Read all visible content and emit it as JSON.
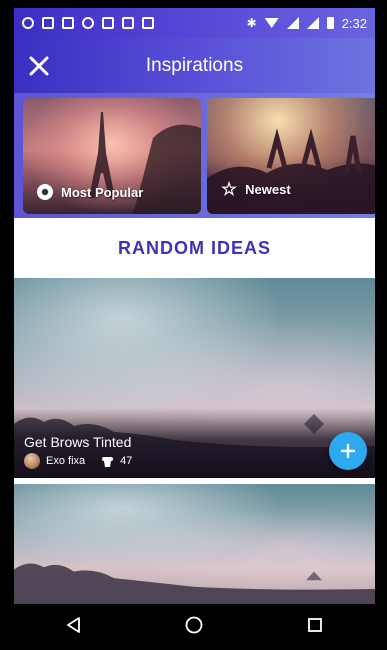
{
  "status_bar": {
    "time": "2:32"
  },
  "header": {
    "title": "Inspirations",
    "close_icon": "close-icon"
  },
  "categories": [
    {
      "label": "Most Popular",
      "icon": "fire-icon"
    },
    {
      "label": "Newest",
      "icon": "star-icon"
    }
  ],
  "section_title": "RANDOM IDEAS",
  "ideas": [
    {
      "title": "Get Brows Tinted",
      "author": "Exo fixa",
      "likes": "47"
    }
  ],
  "colors": {
    "header_start": "#3a2fc0",
    "header_end": "#6c73e0",
    "accent": "#3b34b8",
    "add_button": "#2ea8f0"
  },
  "nav": [
    "back-icon",
    "home-icon",
    "recents-icon"
  ]
}
